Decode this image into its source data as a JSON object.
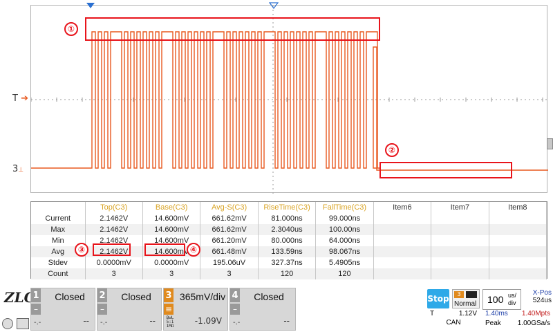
{
  "waveform": {
    "trigger_label": "T",
    "channel_label": "3",
    "annotations": [
      "①",
      "②",
      "③",
      "④"
    ]
  },
  "measurement": {
    "headers": [
      "",
      "Top(C3)",
      "Base(C3)",
      "Avg-S(C3)",
      "RiseTime(C3)",
      "FallTime(C3)",
      "Item6",
      "Item7",
      "Item8"
    ],
    "rows": [
      {
        "label": "Current",
        "cells": [
          "2.1462V",
          "14.600mV",
          "661.62mV",
          "81.000ns",
          "99.000ns",
          "",
          "",
          ""
        ]
      },
      {
        "label": "Max",
        "cells": [
          "2.1462V",
          "14.600mV",
          "661.62mV",
          "2.3040us",
          "100.00ns",
          "",
          "",
          ""
        ]
      },
      {
        "label": "Min",
        "cells": [
          "2.1462V",
          "14.600mV",
          "661.20mV",
          "80.000ns",
          "64.000ns",
          "",
          "",
          ""
        ]
      },
      {
        "label": "Avg",
        "cells": [
          "2.1462V",
          "14.600mV",
          "661.48mV",
          "133.59ns",
          "98.067ns",
          "",
          "",
          ""
        ]
      },
      {
        "label": "Stdev",
        "cells": [
          "0.0000mV",
          "0.0000mV",
          "195.06uV",
          "327.37ns",
          "5.4905ns",
          "",
          "",
          ""
        ]
      },
      {
        "label": "Count",
        "cells": [
          "3",
          "3",
          "3",
          "120",
          "120",
          "",
          "",
          ""
        ]
      }
    ]
  },
  "channels": [
    {
      "num": "1",
      "title": "Closed",
      "offset1": "-.-",
      "offset2": "--",
      "active": false
    },
    {
      "num": "2",
      "title": "Closed",
      "offset1": "-.-",
      "offset2": "--",
      "active": false
    },
    {
      "num": "3",
      "title": "365mV/div",
      "offset1": "",
      "offset2": "-1.09V",
      "active": true,
      "coupling": "BwL 5:1 1MΩ"
    },
    {
      "num": "4",
      "title": "Closed",
      "offset1": "-.-",
      "offset2": "--",
      "active": false
    }
  ],
  "status": {
    "stop": "Stop",
    "trig_ch": "3",
    "mode": "Normal",
    "trig_label": "T",
    "trig_level": "1.12V",
    "protocol": "CAN",
    "timebase": "100",
    "timebase_unit_top": "us/",
    "timebase_unit_bottom": "div",
    "xpos_label": "X-Pos",
    "xpos_value": "524us",
    "mem1": "1.40ms",
    "mem2": "1.40Mpts",
    "peak_label": "Peak",
    "rate": "1.00GSa/s"
  },
  "logo": "ZLG",
  "colors": {
    "waveform": "#e8591f",
    "annotation": "#e8141b",
    "header": "#d9a323",
    "stop": "#2ea9e8"
  }
}
